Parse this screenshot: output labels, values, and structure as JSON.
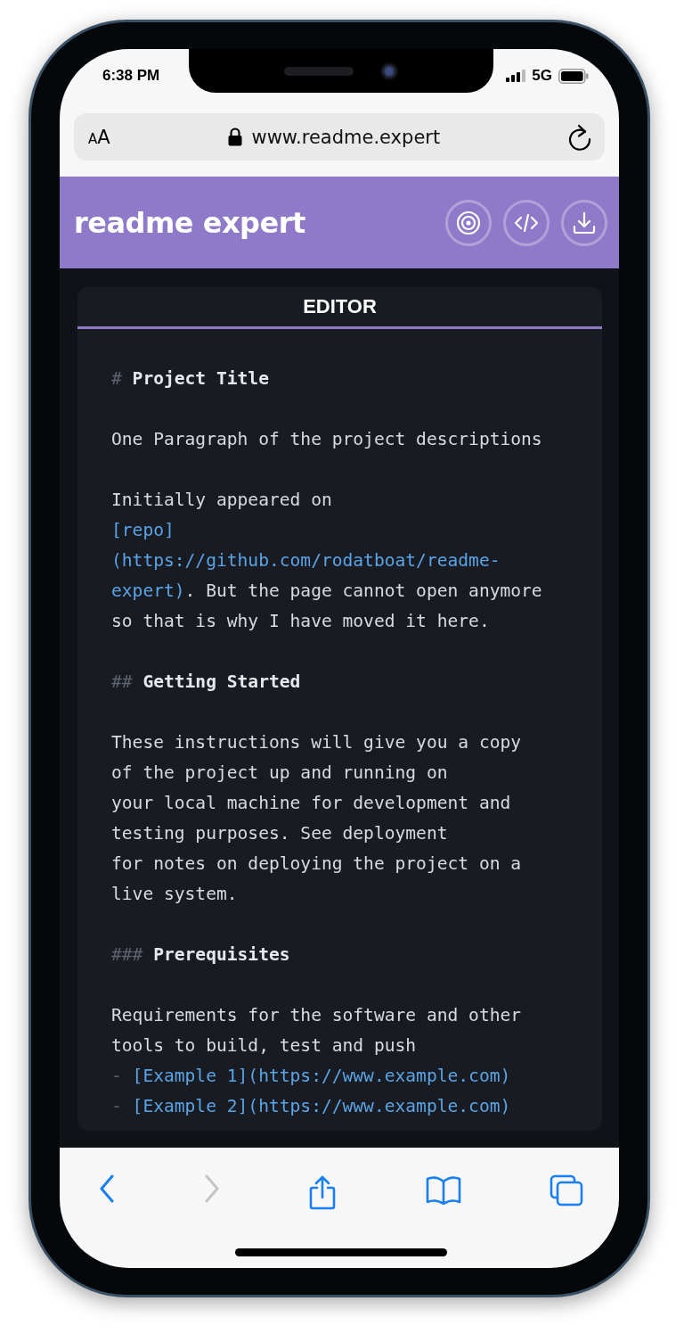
{
  "status_bar": {
    "time": "6:38 PM",
    "network": "5G"
  },
  "browser": {
    "text_size_label": "AA",
    "url": "www.readme.expert"
  },
  "header": {
    "title": "readme expert",
    "actions": [
      {
        "kind": "target"
      },
      {
        "kind": "code"
      },
      {
        "kind": "download"
      }
    ]
  },
  "editor": {
    "tab": "EDITOR",
    "lines": [
      {
        "segments": [
          {
            "kind": "marker",
            "text": "#"
          },
          {
            "kind": "heading",
            "text": " Project Title"
          }
        ]
      },
      {
        "kind": "blank"
      },
      {
        "segments": [
          {
            "kind": "plain",
            "text": "One Paragraph of the project descriptions"
          }
        ]
      },
      {
        "kind": "blank"
      },
      {
        "segments": [
          {
            "kind": "plain",
            "text": "Initially appeared on"
          }
        ]
      },
      {
        "segments": [
          {
            "kind": "link",
            "text": "[repo]"
          }
        ]
      },
      {
        "segments": [
          {
            "kind": "link",
            "text": "(https://github.com/rodatboat/readme-"
          }
        ]
      },
      {
        "segments": [
          {
            "kind": "link",
            "text": "expert)"
          },
          {
            "kind": "plain",
            "text": ". But the page cannot open anymore"
          }
        ]
      },
      {
        "segments": [
          {
            "kind": "plain",
            "text": "so that is why I have moved it here."
          }
        ]
      },
      {
        "kind": "blank"
      },
      {
        "segments": [
          {
            "kind": "marker",
            "text": "##"
          },
          {
            "kind": "heading",
            "text": " Getting Started"
          }
        ]
      },
      {
        "kind": "blank"
      },
      {
        "segments": [
          {
            "kind": "plain",
            "text": "These instructions will give you a copy"
          }
        ]
      },
      {
        "segments": [
          {
            "kind": "plain",
            "text": "of the project up and running on"
          }
        ]
      },
      {
        "segments": [
          {
            "kind": "plain",
            "text": "your local machine for development and"
          }
        ]
      },
      {
        "segments": [
          {
            "kind": "plain",
            "text": "testing purposes. See deployment"
          }
        ]
      },
      {
        "segments": [
          {
            "kind": "plain",
            "text": "for notes on deploying the project on a"
          }
        ]
      },
      {
        "segments": [
          {
            "kind": "plain",
            "text": "live system."
          }
        ]
      },
      {
        "kind": "blank"
      },
      {
        "segments": [
          {
            "kind": "marker",
            "text": "###"
          },
          {
            "kind": "heading",
            "text": " Prerequisites"
          }
        ]
      },
      {
        "kind": "blank"
      },
      {
        "segments": [
          {
            "kind": "plain",
            "text": "Requirements for the software and other"
          }
        ]
      },
      {
        "segments": [
          {
            "kind": "plain",
            "text": "tools to build, test and push"
          }
        ]
      },
      {
        "segments": [
          {
            "kind": "marker",
            "text": "-"
          },
          {
            "kind": "link",
            "text": " [Example 1](https://www.example.com)"
          }
        ]
      },
      {
        "segments": [
          {
            "kind": "marker",
            "text": "-"
          },
          {
            "kind": "link",
            "text": " [Example 2](https://www.example.com)"
          }
        ]
      }
    ]
  },
  "toolbar": {
    "buttons": [
      {
        "kind": "back",
        "disabled": false
      },
      {
        "kind": "forward",
        "disabled": true
      },
      {
        "kind": "share",
        "disabled": false
      },
      {
        "kind": "bookmarks",
        "disabled": false
      },
      {
        "kind": "tabs",
        "disabled": false
      }
    ]
  }
}
